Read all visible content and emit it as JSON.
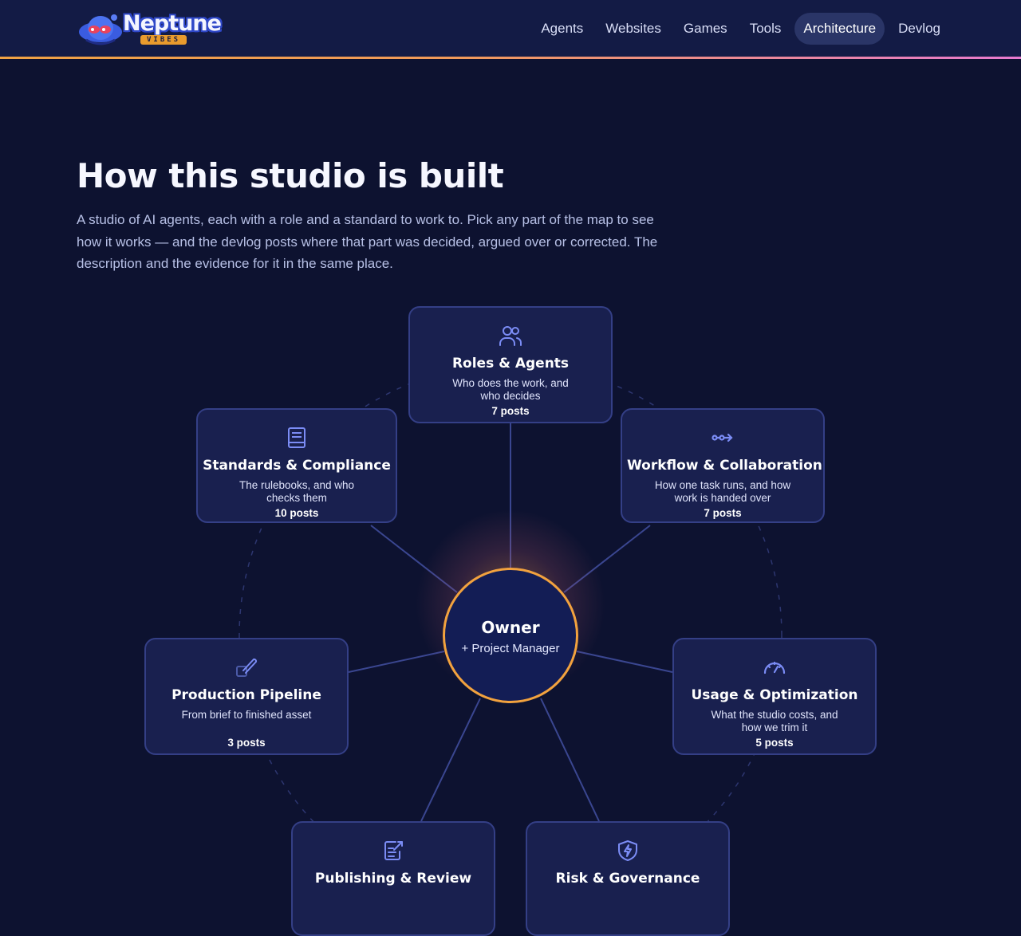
{
  "header": {
    "logo_text": "Neptune",
    "logo_subtext": "VIBES",
    "nav": [
      {
        "label": "Agents"
      },
      {
        "label": "Websites"
      },
      {
        "label": "Games"
      },
      {
        "label": "Tools"
      },
      {
        "label": "Architecture",
        "active": true
      },
      {
        "label": "Devlog"
      }
    ]
  },
  "hero": {
    "title": "How this studio is built",
    "description": "A studio of AI agents, each with a role and a standard to work to. Pick any part of the map to see how it works — and the devlog posts where that part was decided, argued over or corrected. The description and the evidence for it in the same place."
  },
  "map": {
    "center": {
      "title": "Owner",
      "subtitle": "+ Project Manager"
    },
    "nodes": [
      {
        "icon": "users-icon",
        "title": "Roles & Agents",
        "description": "Who does the work, and who decides",
        "posts": "7 posts"
      },
      {
        "icon": "book-icon",
        "title": "Standards & Compliance",
        "description": "The rulebooks, and who checks them",
        "posts": "10 posts"
      },
      {
        "icon": "workflow-icon",
        "title": "Workflow & Collaboration",
        "description": "How one task runs, and how work is handed over",
        "posts": "7 posts"
      },
      {
        "icon": "brush-icon",
        "title": "Production Pipeline",
        "description": "From brief to finished asset",
        "posts": "3 posts"
      },
      {
        "icon": "gauge-icon",
        "title": "Usage & Optimization",
        "description": "What the studio costs, and how we trim it",
        "posts": "5 posts"
      },
      {
        "icon": "edit-document-icon",
        "title": "Publishing & Review",
        "description": "",
        "posts": ""
      },
      {
        "icon": "shield-bolt-icon",
        "title": "Risk & Governance",
        "description": "",
        "posts": ""
      }
    ]
  },
  "colors": {
    "background": "#0d1230",
    "header": "#131b45",
    "card": "#19204f",
    "card_border": "#343f86",
    "accent_orange": "#f2a23e",
    "accent_pink": "#e77ad0",
    "icon": "#7b8cf5"
  }
}
